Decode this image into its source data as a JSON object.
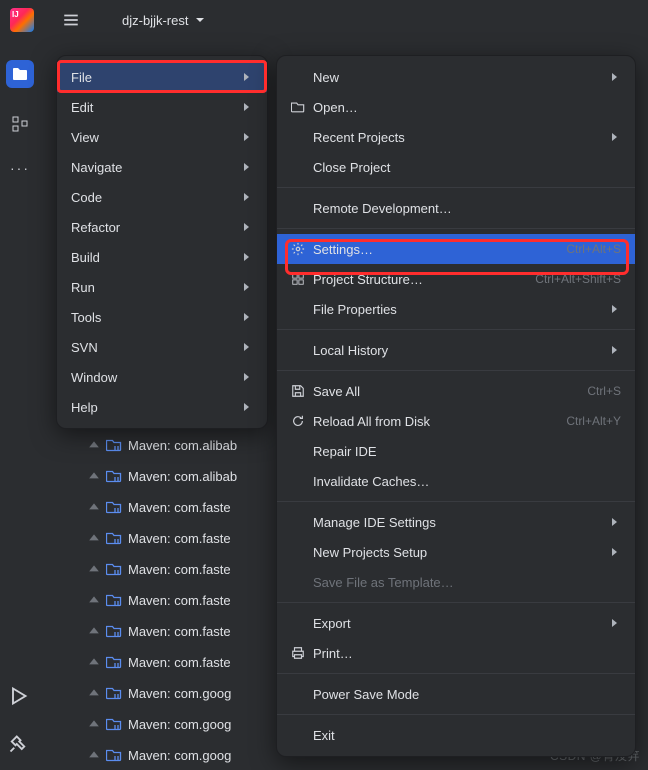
{
  "project_name": "djz-bjjk-rest",
  "menu1": {
    "items": [
      {
        "label": "File",
        "arrow": true,
        "hl": true
      },
      {
        "label": "Edit",
        "arrow": true
      },
      {
        "label": "View",
        "arrow": true
      },
      {
        "label": "Navigate",
        "arrow": true
      },
      {
        "label": "Code",
        "arrow": true
      },
      {
        "label": "Refactor",
        "arrow": true
      },
      {
        "label": "Build",
        "arrow": true
      },
      {
        "label": "Run",
        "arrow": true
      },
      {
        "label": "Tools",
        "arrow": true
      },
      {
        "label": "SVN",
        "arrow": true
      },
      {
        "label": "Window",
        "arrow": true
      },
      {
        "label": "Help",
        "arrow": true
      }
    ]
  },
  "menu2": {
    "items": [
      {
        "label": "New",
        "arrow": true
      },
      {
        "label": "Open…",
        "icon": "folder"
      },
      {
        "label": "Recent Projects",
        "arrow": true
      },
      {
        "label": "Close Project"
      },
      {
        "sep": true
      },
      {
        "label": "Remote Development…"
      },
      {
        "sep": true
      },
      {
        "label": "Settings…",
        "icon": "gear",
        "shortcut": "Ctrl+Alt+S",
        "sel": true
      },
      {
        "label": "Project Structure…",
        "icon": "structure",
        "shortcut": "Ctrl+Alt+Shift+S"
      },
      {
        "label": "File Properties",
        "arrow": true
      },
      {
        "sep": true
      },
      {
        "label": "Local History",
        "arrow": true
      },
      {
        "sep": true
      },
      {
        "label": "Save All",
        "icon": "save",
        "shortcut": "Ctrl+S"
      },
      {
        "label": "Reload All from Disk",
        "icon": "reload",
        "shortcut": "Ctrl+Alt+Y"
      },
      {
        "label": "Repair IDE"
      },
      {
        "label": "Invalidate Caches…"
      },
      {
        "sep": true
      },
      {
        "label": "Manage IDE Settings",
        "arrow": true
      },
      {
        "label": "New Projects Setup",
        "arrow": true
      },
      {
        "label": "Save File as Template…",
        "disabled": true
      },
      {
        "sep": true
      },
      {
        "label": "Export",
        "arrow": true
      },
      {
        "label": "Print…",
        "icon": "print"
      },
      {
        "sep": true
      },
      {
        "label": "Power Save Mode"
      },
      {
        "sep": true
      },
      {
        "label": "Exit"
      }
    ]
  },
  "tree": [
    "Maven: com.alibab",
    "Maven: com.alibab",
    "Maven: com.faste",
    "Maven: com.faste",
    "Maven: com.faste",
    "Maven: com.faste",
    "Maven: com.faste",
    "Maven: com.faste",
    "Maven: com.goog",
    "Maven: com.goog",
    "Maven: com.goog"
  ],
  "watermark": "CSDN @青及笄"
}
